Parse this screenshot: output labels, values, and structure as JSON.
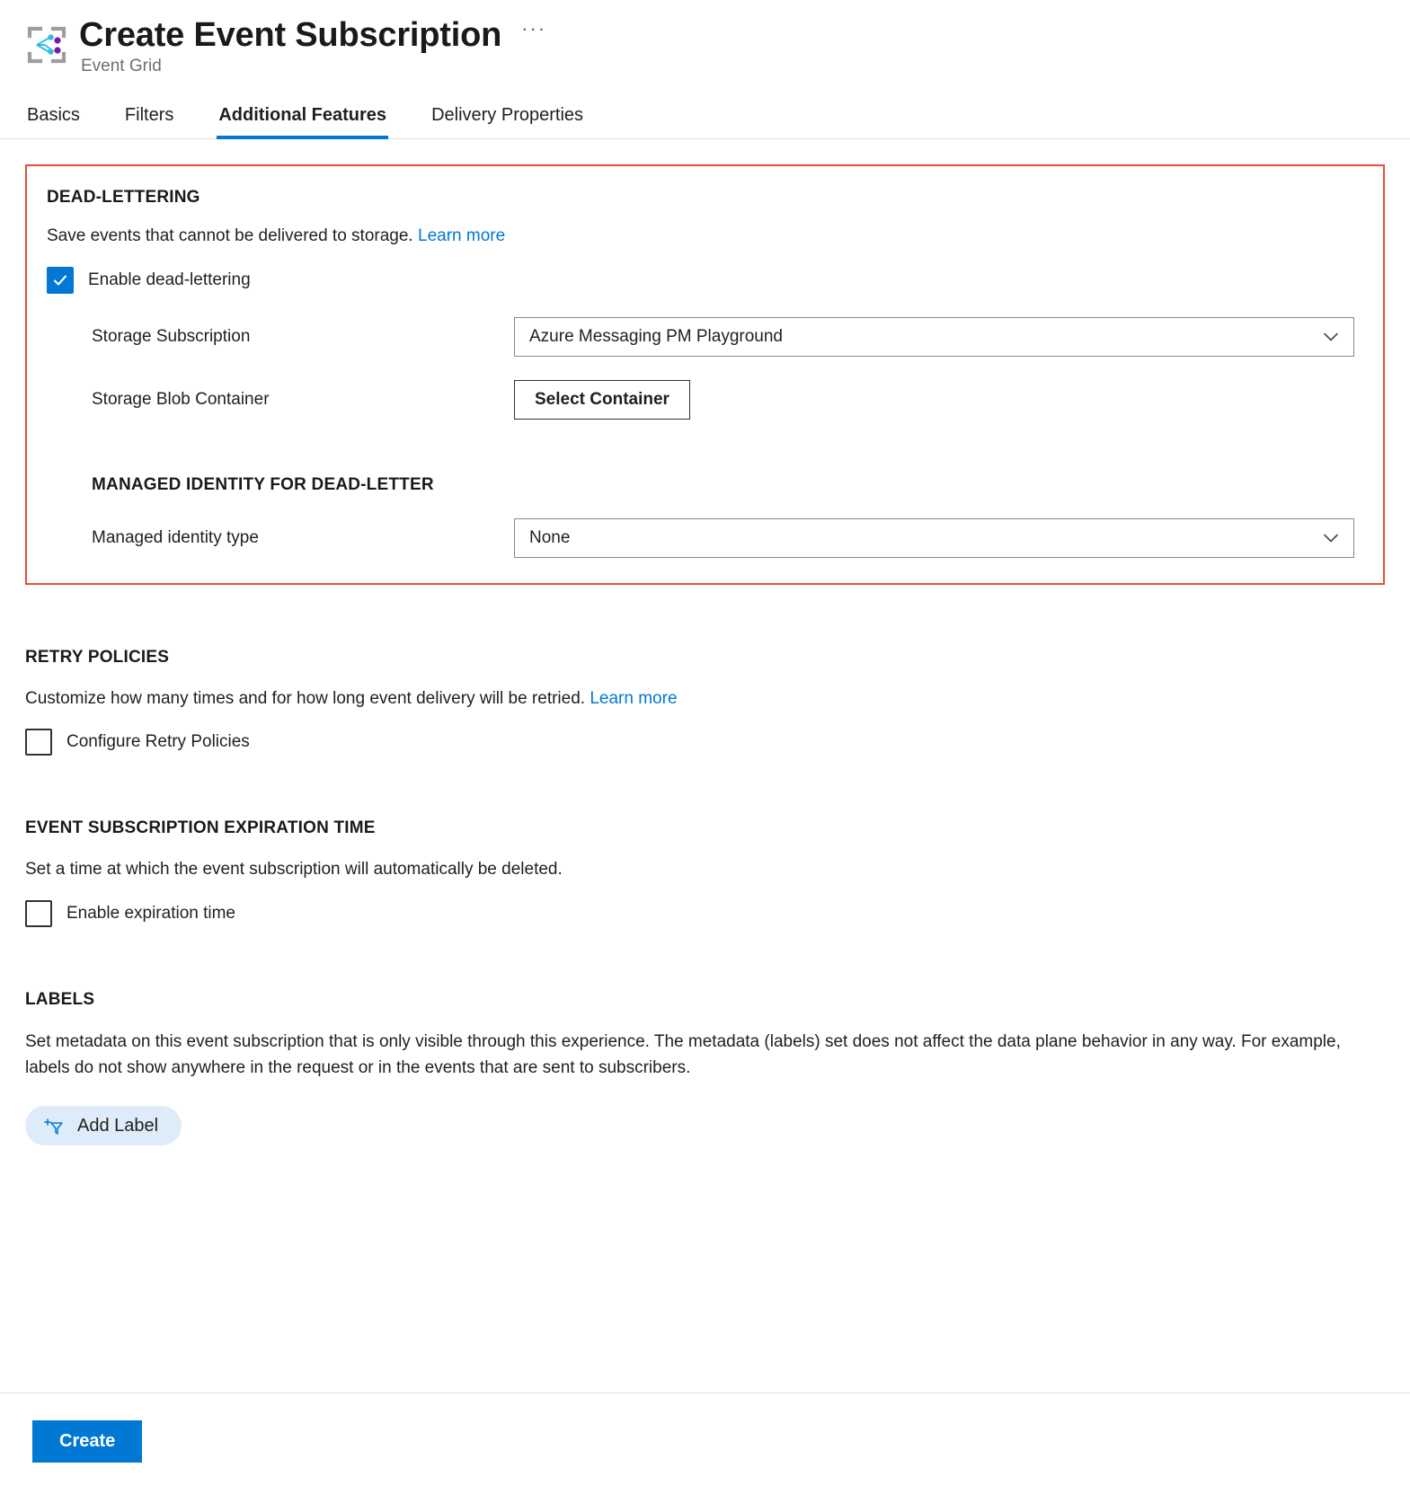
{
  "header": {
    "title": "Create Event Subscription",
    "subtitle": "Event Grid",
    "more_label": "···",
    "icon": "event-grid-icon"
  },
  "tabs": [
    {
      "label": "Basics",
      "active": false
    },
    {
      "label": "Filters",
      "active": false
    },
    {
      "label": "Additional Features",
      "active": true
    },
    {
      "label": "Delivery Properties",
      "active": false
    }
  ],
  "dead_lettering": {
    "heading": "DEAD-LETTERING",
    "description": "Save events that cannot be delivered to storage.",
    "learn_more": "Learn more",
    "enable_checkbox_label": "Enable dead-lettering",
    "enable_checked": true,
    "storage_subscription_label": "Storage Subscription",
    "storage_subscription_value": "Azure Messaging PM Playground",
    "storage_blob_container_label": "Storage Blob Container",
    "select_container_button": "Select Container",
    "managed_identity_heading": "MANAGED IDENTITY FOR DEAD-LETTER",
    "managed_identity_type_label": "Managed identity type",
    "managed_identity_type_value": "None",
    "highlight_color": "#e74c3c"
  },
  "retry_policies": {
    "heading": "RETRY POLICIES",
    "description": "Customize how many times and for how long event delivery will be retried.",
    "learn_more": "Learn more",
    "checkbox_label": "Configure Retry Policies",
    "checked": false
  },
  "expiration": {
    "heading": "EVENT SUBSCRIPTION EXPIRATION TIME",
    "description": "Set a time at which the event subscription will automatically be deleted.",
    "checkbox_label": "Enable expiration time",
    "checked": false
  },
  "labels": {
    "heading": "LABELS",
    "description": "Set metadata on this event subscription that is only visible through this experience. The metadata (labels) set does not affect the data plane behavior in any way. For example, labels do not show anywhere in the request or in the events that are sent to subscribers.",
    "add_label_button": "Add Label",
    "add_label_icon": "add-filter-icon"
  },
  "footer": {
    "create_button": "Create",
    "accent_color": "#0078d4"
  }
}
